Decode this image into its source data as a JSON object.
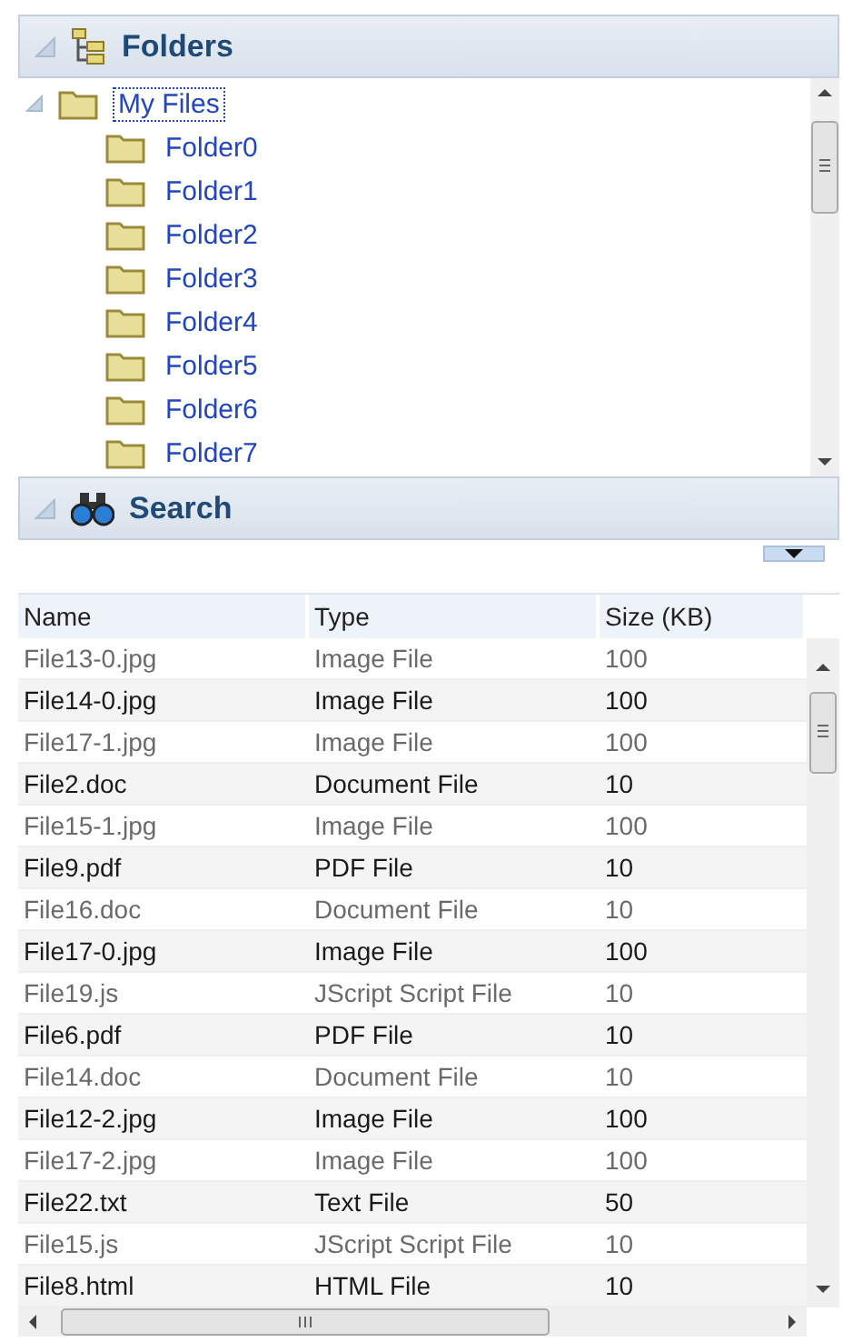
{
  "folders_panel": {
    "title": "Folders",
    "tree": [
      {
        "label": "My Files",
        "expanded": true,
        "selected": true,
        "children": [
          {
            "label": "Folder0",
            "selected": false
          },
          {
            "label": "Folder1",
            "selected": false
          },
          {
            "label": "Folder2",
            "selected": false
          },
          {
            "label": "Folder3",
            "selected": false
          },
          {
            "label": "Folder4",
            "selected": false
          },
          {
            "label": "Folder5",
            "selected": false
          },
          {
            "label": "Folder6",
            "selected": false
          },
          {
            "label": "Folder7",
            "selected": false
          }
        ]
      }
    ]
  },
  "search_panel": {
    "title": "Search",
    "table": {
      "columns": [
        "Name",
        "Type",
        "Size (KB)"
      ],
      "rows": [
        [
          "File13-0.jpg",
          "Image File",
          "100"
        ],
        [
          "File14-0.jpg",
          "Image File",
          "100"
        ],
        [
          "File17-1.jpg",
          "Image File",
          "100"
        ],
        [
          "File2.doc",
          "Document File",
          "10"
        ],
        [
          "File15-1.jpg",
          "Image File",
          "100"
        ],
        [
          "File9.pdf",
          "PDF File",
          "10"
        ],
        [
          "File16.doc",
          "Document File",
          "10"
        ],
        [
          "File17-0.jpg",
          "Image File",
          "100"
        ],
        [
          "File19.js",
          "JScript Script File",
          "10"
        ],
        [
          "File6.pdf",
          "PDF File",
          "10"
        ],
        [
          "File14.doc",
          "Document File",
          "10"
        ],
        [
          "File12-2.jpg",
          "Image File",
          "100"
        ],
        [
          "File17-2.jpg",
          "Image File",
          "100"
        ],
        [
          "File22.txt",
          "Text File",
          "50"
        ],
        [
          "File15.js",
          "JScript Script File",
          "10"
        ],
        [
          "File8.html",
          "HTML File",
          "10"
        ]
      ]
    }
  }
}
